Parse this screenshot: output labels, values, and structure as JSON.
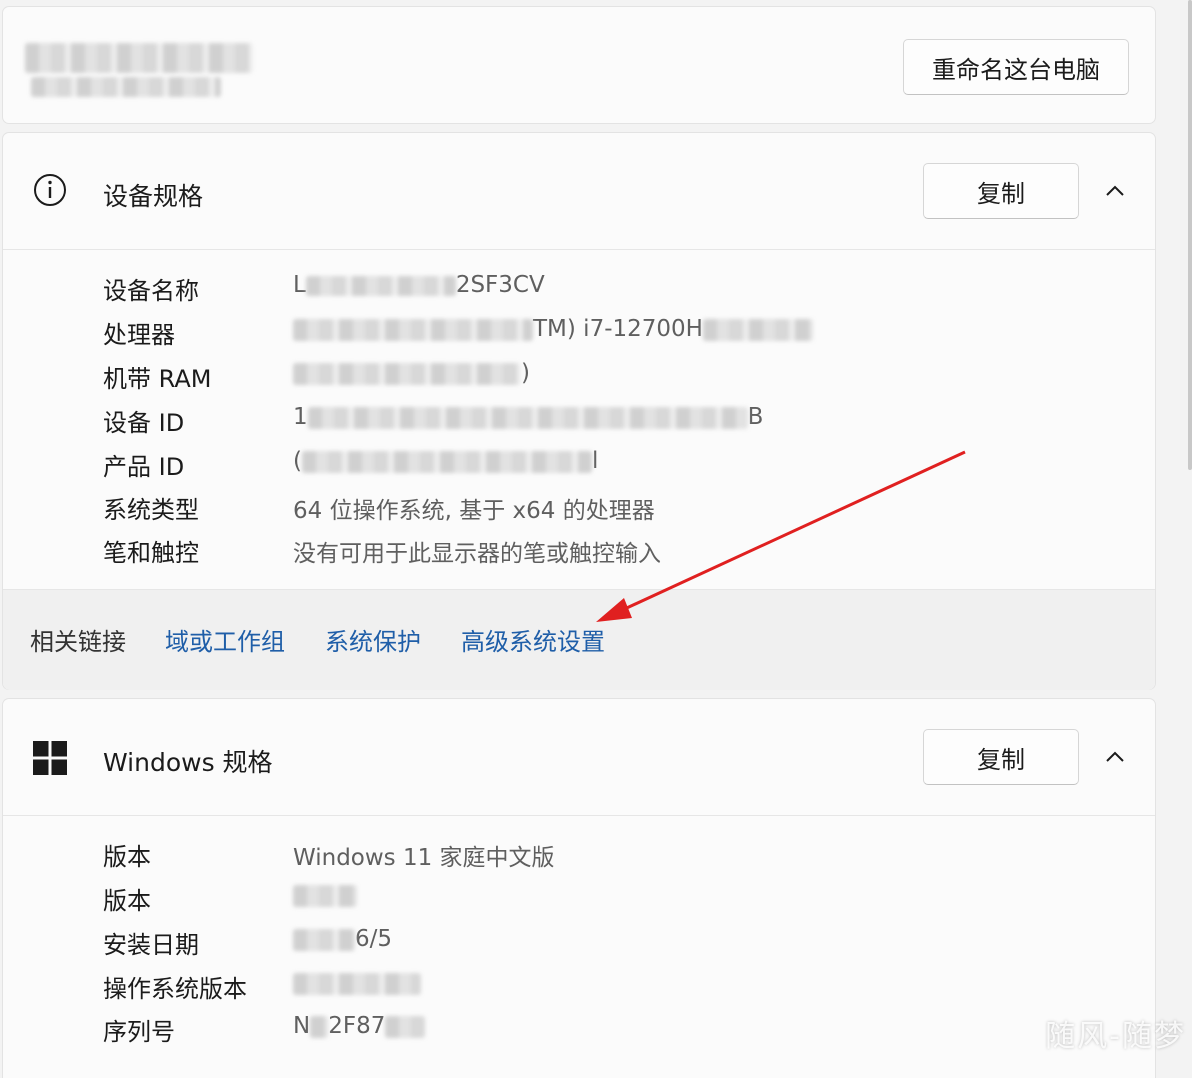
{
  "top_card": {
    "rename_button": "重命名这台电脑"
  },
  "device_specs": {
    "title": "设备规格",
    "icon": "info-icon",
    "copy_button": "复制",
    "rows": [
      {
        "label": "设备名称",
        "value_prefix": "L",
        "value_suffix": "2SF3CV"
      },
      {
        "label": "处理器",
        "value_prefix": "",
        "value_suffix": "TM) i7-12700H"
      },
      {
        "label": "机带 RAM",
        "value_prefix": "",
        "value_suffix": ")"
      },
      {
        "label": "设备 ID",
        "value_prefix": "1",
        "value_suffix": "B"
      },
      {
        "label": "产品 ID",
        "value_prefix": "(",
        "value_suffix": "l"
      },
      {
        "label": "系统类型",
        "value": "64 位操作系统, 基于 x64 的处理器"
      },
      {
        "label": "笔和触控",
        "value": "没有可用于此显示器的笔或触控输入"
      }
    ],
    "related_links": {
      "label": "相关链接",
      "links": [
        "域或工作组",
        "系统保护",
        "高级系统设置"
      ]
    }
  },
  "windows_specs": {
    "title": "Windows 规格",
    "icon": "windows-logo-icon",
    "copy_button": "复制",
    "rows": [
      {
        "label": "版本",
        "value": "Windows 11 家庭中文版"
      },
      {
        "label": "版本",
        "value_prefix": "",
        "value_suffix": ""
      },
      {
        "label": "安装日期",
        "value_prefix": "",
        "value_suffix": "6/5"
      },
      {
        "label": "操作系统版本",
        "value_prefix": "",
        "value_suffix": ""
      },
      {
        "label": "序列号",
        "value_prefix": "N",
        "value_suffix": "2F87"
      }
    ]
  },
  "watermark": "随风-随梦",
  "colors": {
    "link": "#1f5ea8",
    "annotation_arrow": "#e02020"
  }
}
